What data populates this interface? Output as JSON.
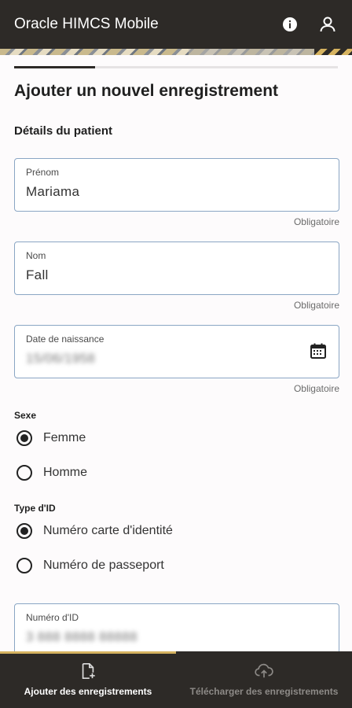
{
  "appbar": {
    "title": "Oracle HIMCS Mobile",
    "info_icon": "info-icon",
    "account_icon": "person-icon"
  },
  "progress": {
    "fraction": 0.25
  },
  "form": {
    "title": "Ajouter un nouvel enregistrement",
    "section": "Détails du patient",
    "first_name": {
      "label": "Prénom",
      "value": "Mariama",
      "helper": "Obligatoire"
    },
    "last_name": {
      "label": "Nom",
      "value": "Fall",
      "helper": "Obligatoire"
    },
    "birth_date": {
      "label": "Date de naissance",
      "value": "15/06/1958",
      "helper": "Obligatoire",
      "icon": "calendar-icon"
    },
    "sex": {
      "label": "Sexe",
      "options": [
        "Femme",
        "Homme"
      ],
      "selected": "Femme"
    },
    "id_type": {
      "label": "Type d'ID",
      "options": [
        "Numéro carte d'identité",
        "Numéro de passeport"
      ],
      "selected": "Numéro carte d'identité"
    },
    "id_number": {
      "label": "Numéro d'ID",
      "value": "3 888 8888 88888"
    }
  },
  "bottom_nav": {
    "items": [
      {
        "label": "Ajouter des enregistrements",
        "icon": "add-file-icon",
        "active": true
      },
      {
        "label": "Télécharger des enregistrements",
        "icon": "cloud-upload-icon",
        "active": false
      }
    ]
  },
  "colors": {
    "appbar": "#2d2a27",
    "accent": "#d6b360",
    "field_border": "#8aa6c4"
  }
}
